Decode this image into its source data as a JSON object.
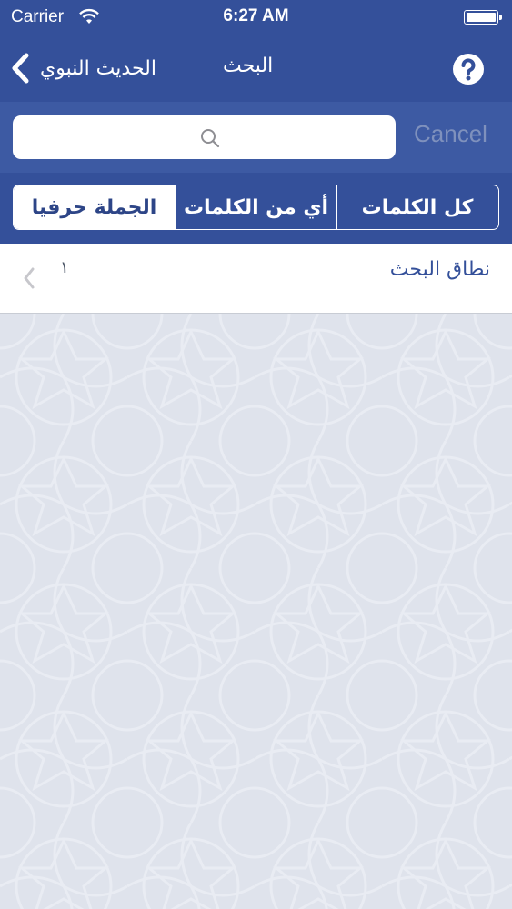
{
  "status_bar": {
    "carrier": "Carrier",
    "time": "6:27 AM",
    "icons": [
      "wifi-icon",
      "battery-icon"
    ]
  },
  "nav": {
    "back_label": "الحديث النبوي",
    "title": "البحث",
    "back_icon": "chevron-left-icon",
    "help_icon": "help-icon"
  },
  "search": {
    "value": "",
    "placeholder": "",
    "cancel_label": "Cancel",
    "icon": "search-icon"
  },
  "scope_segments": {
    "selected": "الجملة حرفيا",
    "items": [
      {
        "label": "الجملة حرفيا"
      },
      {
        "label": "أي من الكلمات"
      },
      {
        "label": "كل الكلمات"
      }
    ]
  },
  "scope_row": {
    "label": "نطاق البحث",
    "value": "١",
    "icon": "chevron-left-icon"
  },
  "colors": {
    "nav_bar": "#34509a",
    "search_bar": "#3d5aa3",
    "background": "#dfe3ec",
    "cancel_text": "#7f91bd",
    "accent_text": "#34509a"
  }
}
